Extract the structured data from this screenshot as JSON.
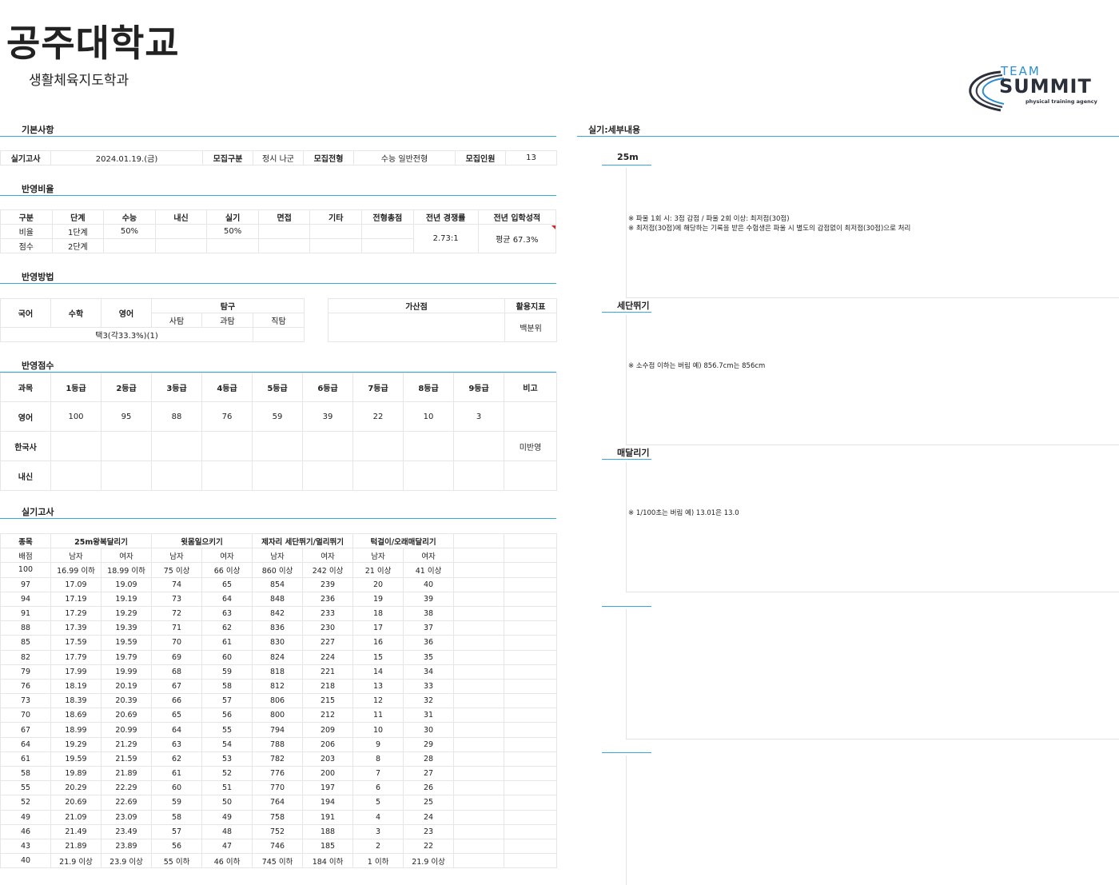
{
  "header": {
    "title": "공주대학교",
    "department": "생활체육지도학과",
    "logo_top": "TEAM",
    "logo_main": "SUMMIT",
    "logo_sub": "physical training agency"
  },
  "colors": {
    "accent": "#35a9d8",
    "logo_blue": "#2d8fcf",
    "logo_dark": "#2a2f3a"
  },
  "sections": {
    "basic": "기본사항",
    "ratio": "반영비율",
    "method": "반영방법",
    "score": "반영점수",
    "practical": "실기고사",
    "detail": "실기:세부내용"
  },
  "basic": {
    "exam_label": "실기고사",
    "exam_date": "2024.01.19.(금)",
    "type_label": "모집구분",
    "type_value": "정시 나군",
    "track_label": "모집전형",
    "track_value": "수능 일반전형",
    "count_label": "모집인원",
    "count_value": "13"
  },
  "ratio": {
    "headers": [
      "구분",
      "단계",
      "수능",
      "내신",
      "실기",
      "면접",
      "기타",
      "전형총점",
      "전년 경쟁률",
      "전년 입학성적"
    ],
    "row1": {
      "label": "비율",
      "stage": "1단계",
      "suneung": "50%",
      "practical": "50%"
    },
    "row2": {
      "label": "점수",
      "stage": "2단계"
    },
    "competition": "2.73:1",
    "admission_score": "평균 67.3%"
  },
  "method": {
    "korean": "국어",
    "math": "수학",
    "english": "영어",
    "inquiry": "탐구",
    "social": "사탐",
    "science": "과탐",
    "vocational": "직탐",
    "bonus": "가산점",
    "index": "활용지표",
    "selection": "택3(각33.3%)(1)",
    "index_value": "백분위"
  },
  "score": {
    "headers": [
      "과목",
      "1등급",
      "2등급",
      "3등급",
      "4등급",
      "5등급",
      "6등급",
      "7등급",
      "8등급",
      "9등급",
      "비고"
    ],
    "rows": [
      {
        "subject": "영어",
        "values": [
          "100",
          "95",
          "88",
          "76",
          "59",
          "39",
          "22",
          "10",
          "3"
        ],
        "note": ""
      },
      {
        "subject": "한국사",
        "values": [
          "",
          "",
          "",
          "",
          "",
          "",
          "",
          "",
          ""
        ],
        "note": "미반영"
      },
      {
        "subject": "내신",
        "values": [
          "",
          "",
          "",
          "",
          "",
          "",
          "",
          "",
          ""
        ],
        "note": ""
      }
    ]
  },
  "practical": {
    "event_label": "종목",
    "score_label": "배점",
    "events": [
      "25m왕복달리기",
      "윗몸일으키기",
      "제자리 세단뛰기/멀리뛰기",
      "턱걸이/오래매달리기"
    ],
    "genders": [
      "남자",
      "여자",
      "남자",
      "여자",
      "남자",
      "여자",
      "남자",
      "여자"
    ],
    "rows": [
      [
        "100",
        "16.99 이하",
        "18.99 이하",
        "75 이상",
        "66 이상",
        "860 이상",
        "242 이상",
        "21 이상",
        "41 이상"
      ],
      [
        "97",
        "17.09",
        "19.09",
        "74",
        "65",
        "854",
        "239",
        "20",
        "40"
      ],
      [
        "94",
        "17.19",
        "19.19",
        "73",
        "64",
        "848",
        "236",
        "19",
        "39"
      ],
      [
        "91",
        "17.29",
        "19.29",
        "72",
        "63",
        "842",
        "233",
        "18",
        "38"
      ],
      [
        "88",
        "17.39",
        "19.39",
        "71",
        "62",
        "836",
        "230",
        "17",
        "37"
      ],
      [
        "85",
        "17.59",
        "19.59",
        "70",
        "61",
        "830",
        "227",
        "16",
        "36"
      ],
      [
        "82",
        "17.79",
        "19.79",
        "69",
        "60",
        "824",
        "224",
        "15",
        "35"
      ],
      [
        "79",
        "17.99",
        "19.99",
        "68",
        "59",
        "818",
        "221",
        "14",
        "34"
      ],
      [
        "76",
        "18.19",
        "20.19",
        "67",
        "58",
        "812",
        "218",
        "13",
        "33"
      ],
      [
        "73",
        "18.39",
        "20.39",
        "66",
        "57",
        "806",
        "215",
        "12",
        "32"
      ],
      [
        "70",
        "18.69",
        "20.69",
        "65",
        "56",
        "800",
        "212",
        "11",
        "31"
      ],
      [
        "67",
        "18.99",
        "20.99",
        "64",
        "55",
        "794",
        "209",
        "10",
        "30"
      ],
      [
        "64",
        "19.29",
        "21.29",
        "63",
        "54",
        "788",
        "206",
        "9",
        "29"
      ],
      [
        "61",
        "19.59",
        "21.59",
        "62",
        "53",
        "782",
        "203",
        "8",
        "28"
      ],
      [
        "58",
        "19.89",
        "21.89",
        "61",
        "52",
        "776",
        "200",
        "7",
        "27"
      ],
      [
        "55",
        "20.29",
        "22.29",
        "60",
        "51",
        "770",
        "197",
        "6",
        "26"
      ],
      [
        "52",
        "20.69",
        "22.69",
        "59",
        "50",
        "764",
        "194",
        "5",
        "25"
      ],
      [
        "49",
        "21.09",
        "23.09",
        "58",
        "49",
        "758",
        "191",
        "4",
        "24"
      ],
      [
        "46",
        "21.49",
        "23.49",
        "57",
        "48",
        "752",
        "188",
        "3",
        "23"
      ],
      [
        "43",
        "21.89",
        "23.89",
        "56",
        "47",
        "746",
        "185",
        "2",
        "22"
      ],
      [
        "40",
        "21.9 이상",
        "23.9 이상",
        "55 이하",
        "46 이하",
        "745 이하",
        "184 이하",
        "1 이하",
        "21.9 이상"
      ]
    ]
  },
  "details": [
    {
      "title": "25m",
      "lines": [
        "※ 파울 1회 시: 3점 감점 / 파울 2회 이상: 최저점(30점)",
        "※ 최저점(30점)에 해당하는 기록을 받은 수험생은 파울 시 별도의 감점없이 최저점(30점)으로 처리"
      ]
    },
    {
      "title": "세단뛰기",
      "lines": [
        "※ 소수점 이하는 버림  예) 856.7cm는 856cm"
      ]
    },
    {
      "title": "매달리기",
      "lines": [
        "※ 1/100초는 버림  예) 13.01은 13.0"
      ]
    },
    {
      "title": "",
      "lines": []
    },
    {
      "title": "",
      "lines": []
    }
  ]
}
